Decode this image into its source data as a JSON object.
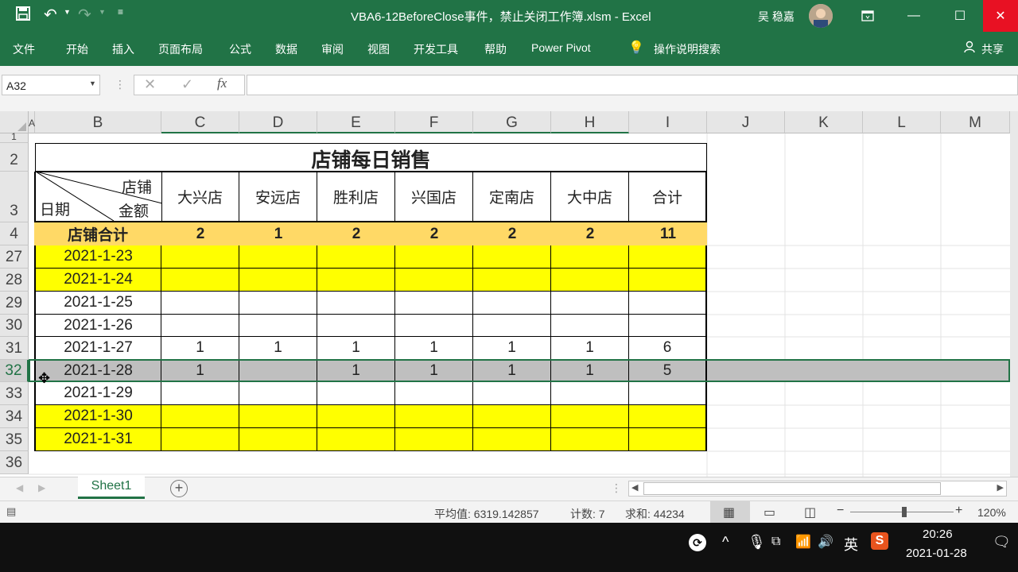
{
  "window": {
    "title": "VBA6-12BeforeClose事件，禁止关闭工作簿.xlsm  -  Excel",
    "user": "吴 稳嘉"
  },
  "ribbon_tabs": [
    "文件",
    "开始",
    "插入",
    "页面布局",
    "公式",
    "数据",
    "审阅",
    "视图",
    "开发工具",
    "帮助",
    "Power Pivot"
  ],
  "tell_me": "操作说明搜索",
  "share": "共享",
  "formula_bar": {
    "name_box": "A32",
    "fx_label": "fx",
    "value": ""
  },
  "columns": [
    "A",
    "B",
    "C",
    "D",
    "E",
    "F",
    "G",
    "H",
    "I",
    "J",
    "K",
    "L",
    "M"
  ],
  "rows": [
    "1",
    "2",
    "3",
    "4",
    "27",
    "28",
    "29",
    "30",
    "31",
    "32",
    "33",
    "34",
    "35",
    "36"
  ],
  "table": {
    "title": "店铺每日销售",
    "corner_top": "店铺",
    "corner_mid": "金额",
    "corner_bottom": "日期",
    "headers": [
      "大兴店",
      "安远店",
      "胜利店",
      "兴国店",
      "定南店",
      "大中店",
      "合计"
    ],
    "summary_label": "店铺合计",
    "summary_values": [
      "2",
      "1",
      "2",
      "2",
      "2",
      "2",
      "11"
    ],
    "data_rows": [
      {
        "date": "2021-1-23",
        "values": [
          "",
          "",
          "",
          "",
          "",
          "",
          ""
        ],
        "fill": "#ffff00"
      },
      {
        "date": "2021-1-24",
        "values": [
          "",
          "",
          "",
          "",
          "",
          "",
          ""
        ],
        "fill": "#ffff00"
      },
      {
        "date": "2021-1-25",
        "values": [
          "",
          "",
          "",
          "",
          "",
          "",
          ""
        ],
        "fill": "#ffffff"
      },
      {
        "date": "2021-1-26",
        "values": [
          "",
          "",
          "",
          "",
          "",
          "",
          ""
        ],
        "fill": "#ffffff"
      },
      {
        "date": "2021-1-27",
        "values": [
          "1",
          "1",
          "1",
          "1",
          "1",
          "1",
          "6"
        ],
        "fill": "#ffffff"
      },
      {
        "date": "2021-1-28",
        "values": [
          "1",
          "",
          "1",
          "1",
          "1",
          "1",
          "5"
        ],
        "fill": "#bfbfbf"
      },
      {
        "date": "2021-1-29",
        "values": [
          "",
          "",
          "",
          "",
          "",
          "",
          ""
        ],
        "fill": "#ffffff"
      },
      {
        "date": "2021-1-30",
        "values": [
          "",
          "",
          "",
          "",
          "",
          "",
          ""
        ],
        "fill": "#ffff00"
      },
      {
        "date": "2021-1-31",
        "values": [
          "",
          "",
          "",
          "",
          "",
          "",
          ""
        ],
        "fill": "#ffff00"
      }
    ]
  },
  "sheet_tab": "Sheet1",
  "status": {
    "average": "平均值: 6319.142857",
    "count": "计数: 7",
    "sum": "求和: 44234",
    "zoom": "120%"
  },
  "taskbar": {
    "ime": "英",
    "time": "20:26",
    "date": "2021-01-28"
  },
  "colors": {
    "excel_green": "#217346",
    "summary_fill": "#ffd966",
    "highlight_fill": "#ffff00",
    "selected_row_fill": "#bfbfbf"
  }
}
